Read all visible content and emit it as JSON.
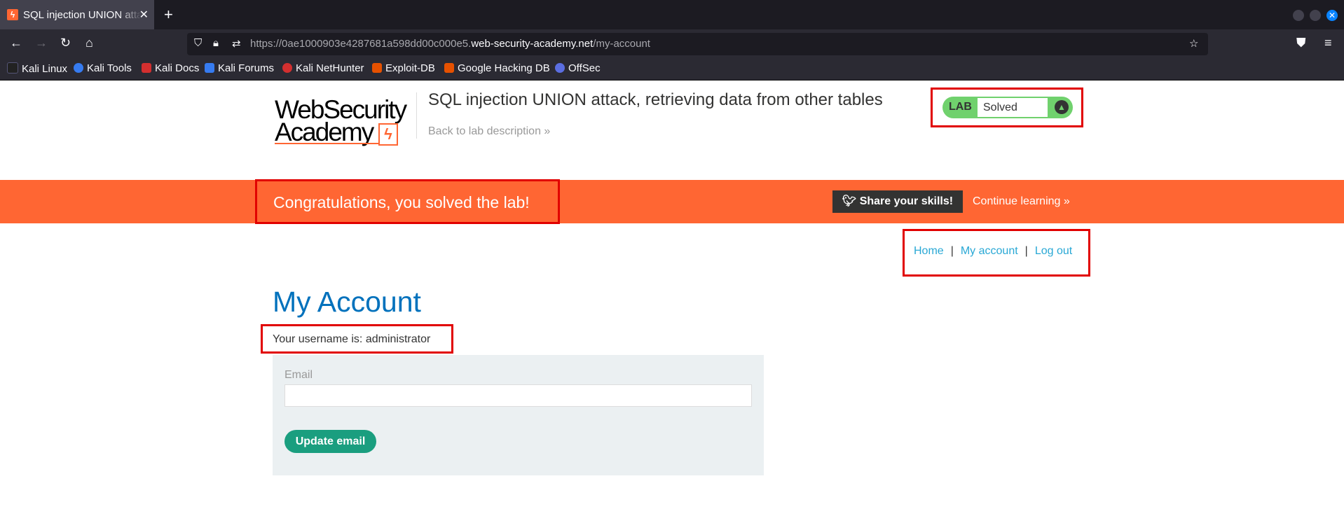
{
  "browser": {
    "tab_title": "SQL injection UNION attack, retrieving data from other tables",
    "url_prefix": "https://0ae1000903e4287681a598dd00c000e5.",
    "url_domain": "web-security-academy.net",
    "url_path": "/my-account",
    "bookmarks": [
      "Kali Linux",
      "Kali Tools",
      "Kali Docs",
      "Kali Forums",
      "Kali NetHunter",
      "Exploit-DB",
      "Google Hacking DB",
      "OffSec"
    ]
  },
  "header": {
    "logo_line1": "WebSecurity",
    "logo_line2": "Academy",
    "lab_title": "SQL injection UNION attack, retrieving data from other tables",
    "back_link": "Back to lab description »",
    "status_label": "LAB",
    "status_value": "Solved"
  },
  "banner": {
    "congrats": "Congratulations, you solved the lab!",
    "share": "Share your skills!",
    "continue": "Continue learning »"
  },
  "nav": {
    "home": "Home",
    "my_account": "My account",
    "log_out": "Log out",
    "separator": "|"
  },
  "main": {
    "heading": "My Account",
    "username_line": "Your username is: administrator",
    "email_label": "Email",
    "email_value": "",
    "update_button": "Update email"
  },
  "colors": {
    "accent": "#ff6633",
    "heading_blue": "#0071bc",
    "link_blue": "#29a8d5",
    "solved_green": "#70d16d",
    "button_green": "#1a9e7f",
    "highlight_red": "#e10000"
  }
}
